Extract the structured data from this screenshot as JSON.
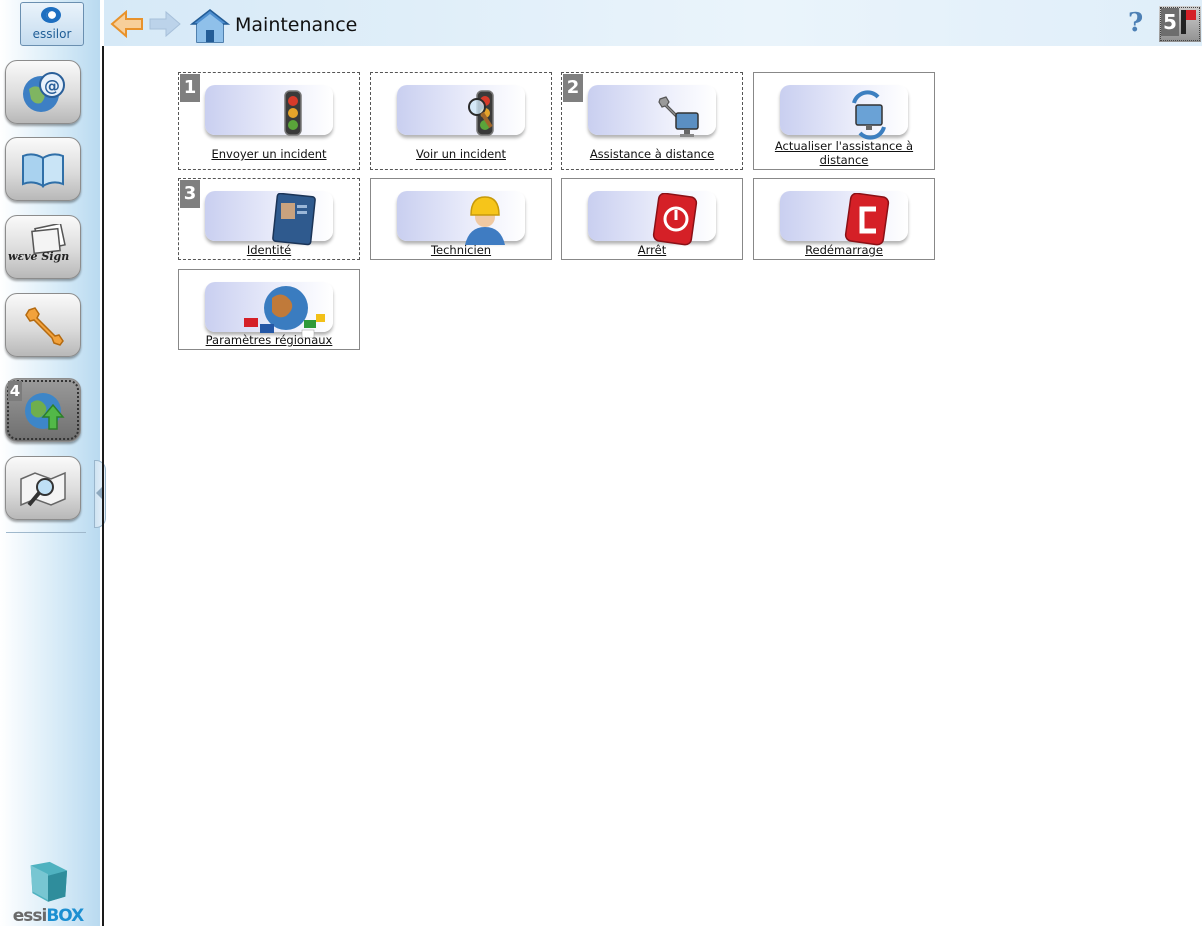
{
  "app": {
    "logo_text": "essilor",
    "brand_part1": "essi",
    "brand_part2": "BOX"
  },
  "header": {
    "title": "Maintenance",
    "help_label": "?",
    "notification_badge": "5"
  },
  "sidebar": {
    "items": [
      {
        "name": "internet",
        "icon": "globe-at-icon"
      },
      {
        "name": "catalog",
        "icon": "open-book-icon"
      },
      {
        "name": "wevesign",
        "icon": "wevesign-icon",
        "text": "wεve Sign"
      },
      {
        "name": "maintenance",
        "icon": "wrench-icon"
      },
      {
        "name": "update",
        "icon": "globe-upload-icon",
        "badge": "4"
      },
      {
        "name": "search",
        "icon": "map-magnifier-icon"
      }
    ]
  },
  "tiles": [
    {
      "label": "Envoyer un incident",
      "badge": "1",
      "icon": "traffic-light-icon"
    },
    {
      "label": "Voir un incident",
      "icon": "traffic-light-magnifier-icon"
    },
    {
      "label": "Assistance à distance",
      "badge": "2",
      "icon": "remote-assistance-icon"
    },
    {
      "label": "Actualiser l'assistance à distance",
      "icon": "refresh-remote-assistance-icon"
    },
    {
      "label": "Identité",
      "badge": "3",
      "icon": "id-card-icon"
    },
    {
      "label": "Technicien",
      "icon": "technician-icon"
    },
    {
      "label": "Arrêt",
      "icon": "power-off-icon"
    },
    {
      "label": "Redémarrage",
      "icon": "restart-icon"
    },
    {
      "label": "Paramètres régionaux",
      "icon": "globe-flags-icon"
    }
  ],
  "colors": {
    "accent_blue": "#1c8fd1",
    "badge_gray": "#7f7f7f",
    "power_red": "#d52027",
    "arrow_orange": "#f2a23c"
  }
}
